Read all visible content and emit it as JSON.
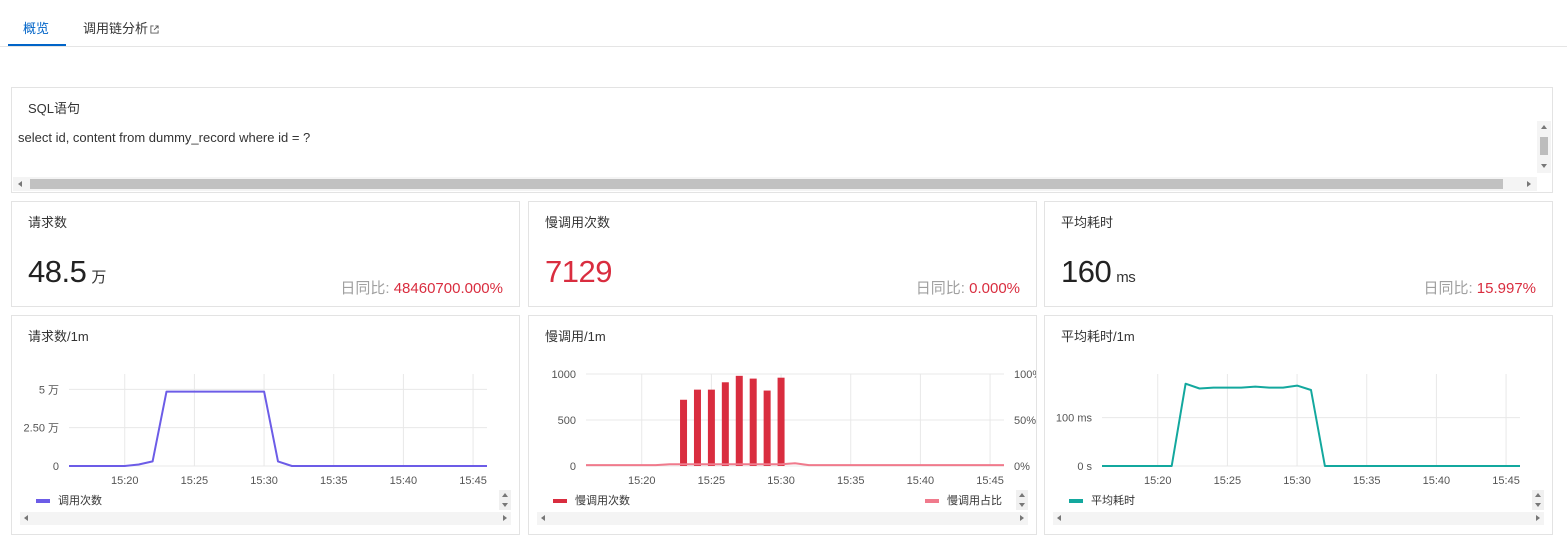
{
  "tabs": [
    {
      "label": "概览"
    },
    {
      "label": "调用链分析"
    }
  ],
  "sql": {
    "title": "SQL语句",
    "statement": "select id, content from dummy_record where id = ?"
  },
  "stats": {
    "requests": {
      "title": "请求数",
      "value": "48.5",
      "unit": "万",
      "cmp_label": "日同比:",
      "cmp_value": "48460700.000%"
    },
    "slow": {
      "title": "慢调用次数",
      "value": "7129",
      "cmp_label": "日同比:",
      "cmp_value": "0.000%"
    },
    "latency": {
      "title": "平均耗时",
      "value": "160",
      "unit": "ms",
      "cmp_label": "日同比:",
      "cmp_value": "15.997%"
    }
  },
  "colors": {
    "accent": "#0064c8",
    "requests_line": "#6c5ce7",
    "slow_bar": "#d92d3f",
    "slow_ratio": "#f07a8c",
    "latency_line": "#13a89e",
    "negative": "#d92d3f"
  },
  "chart_data": [
    {
      "type": "line",
      "title": "请求数/1m",
      "x_ticks": [
        "15:20",
        "15:25",
        "15:30",
        "15:35",
        "15:40",
        "15:45"
      ],
      "y_ticks": [
        "0",
        "2.50 万",
        "5 万"
      ],
      "ylim": [
        0,
        60000
      ],
      "series": [
        {
          "name": "调用次数",
          "x": [
            "15:16",
            "15:17",
            "15:18",
            "15:19",
            "15:20",
            "15:21",
            "15:22",
            "15:23",
            "15:24",
            "15:25",
            "15:26",
            "15:27",
            "15:28",
            "15:29",
            "15:30",
            "15:31",
            "15:32",
            "15:33",
            "15:34",
            "15:35",
            "15:36",
            "15:37",
            "15:38",
            "15:39",
            "15:40",
            "15:41",
            "15:42",
            "15:43",
            "15:44",
            "15:45",
            "15:46"
          ],
          "values": [
            0,
            0,
            0,
            0,
            0,
            1000,
            3000,
            48500,
            48500,
            48500,
            48500,
            48500,
            48500,
            48500,
            48500,
            3000,
            0,
            0,
            0,
            0,
            0,
            0,
            0,
            0,
            0,
            0,
            0,
            0,
            0,
            0,
            0
          ]
        }
      ]
    },
    {
      "type": "bar",
      "title": "慢调用/1m",
      "x_ticks": [
        "15:20",
        "15:25",
        "15:30",
        "15:35",
        "15:40",
        "15:45"
      ],
      "y_ticks": [
        "0",
        "500",
        "1000"
      ],
      "y2_ticks": [
        "0%",
        "50%",
        "100%"
      ],
      "ylim": [
        0,
        1000
      ],
      "y2lim": [
        0,
        100
      ],
      "x": [
        "15:16",
        "15:17",
        "15:18",
        "15:19",
        "15:20",
        "15:21",
        "15:22",
        "15:23",
        "15:24",
        "15:25",
        "15:26",
        "15:27",
        "15:28",
        "15:29",
        "15:30",
        "15:31",
        "15:32",
        "15:33",
        "15:34",
        "15:35",
        "15:36",
        "15:37",
        "15:38",
        "15:39",
        "15:40",
        "15:41",
        "15:42",
        "15:43",
        "15:44",
        "15:45",
        "15:46"
      ],
      "series": [
        {
          "name": "慢调用次数",
          "values": [
            0,
            0,
            0,
            0,
            0,
            0,
            0,
            720,
            830,
            830,
            910,
            980,
            950,
            820,
            960,
            0,
            0,
            0,
            0,
            0,
            0,
            0,
            0,
            0,
            0,
            0,
            0,
            0,
            0,
            0,
            0
          ]
        },
        {
          "name": "慢调用占比",
          "values": [
            1,
            1,
            1,
            1,
            1,
            1,
            2,
            2,
            2,
            2,
            2,
            2,
            2,
            2,
            2,
            3,
            1,
            1,
            1,
            1,
            1,
            1,
            1,
            1,
            1,
            1,
            1,
            1,
            1,
            1,
            1
          ]
        }
      ]
    },
    {
      "type": "line",
      "title": "平均耗时/1m",
      "x_ticks": [
        "15:20",
        "15:25",
        "15:30",
        "15:35",
        "15:40",
        "15:45"
      ],
      "y_ticks": [
        "0 s",
        "100 ms"
      ],
      "ylim": [
        0,
        190
      ],
      "series": [
        {
          "name": "平均耗时",
          "x": [
            "15:16",
            "15:17",
            "15:18",
            "15:19",
            "15:20",
            "15:21",
            "15:22",
            "15:23",
            "15:24",
            "15:25",
            "15:26",
            "15:27",
            "15:28",
            "15:29",
            "15:30",
            "15:31",
            "15:32",
            "15:33",
            "15:34",
            "15:35",
            "15:36",
            "15:37",
            "15:38",
            "15:39",
            "15:40",
            "15:41",
            "15:42",
            "15:43",
            "15:44",
            "15:45",
            "15:46"
          ],
          "values": [
            0,
            0,
            0,
            0,
            0,
            0,
            170,
            160,
            162,
            162,
            162,
            164,
            162,
            162,
            166,
            157,
            0,
            0,
            0,
            0,
            0,
            0,
            0,
            0,
            0,
            0,
            0,
            0,
            0,
            0,
            0
          ]
        }
      ]
    }
  ]
}
